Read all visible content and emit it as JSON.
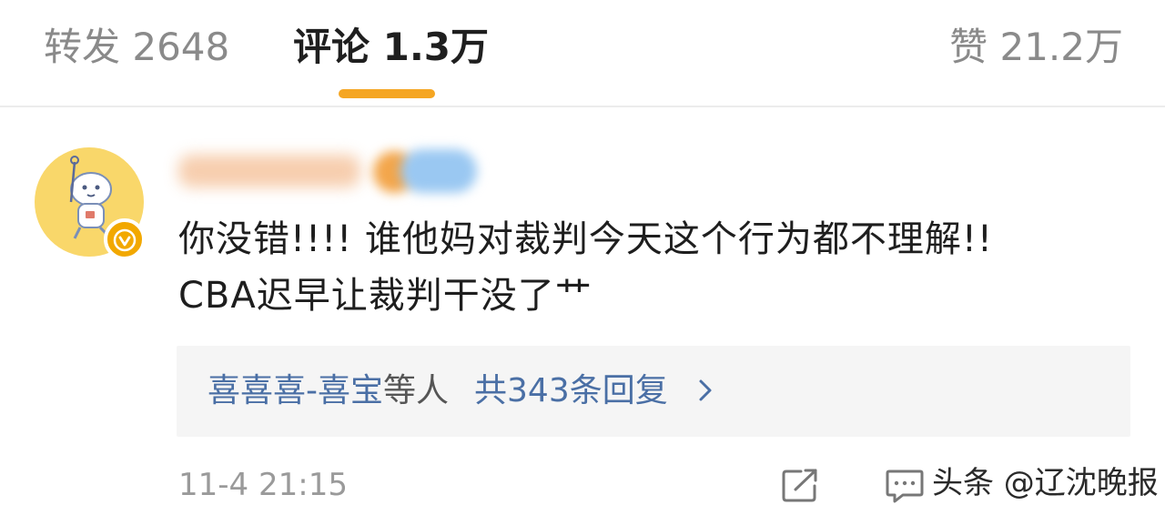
{
  "tabs": {
    "repost_label": "转发 2648",
    "comments_label": "评论 1.3万",
    "likes_label": "赞 21.2万"
  },
  "colors": {
    "accent": "#f5a623",
    "link": "#4a6fa5",
    "avatar_bg": "#f9d76a",
    "verified_badge": "#f2a800"
  },
  "comment": {
    "username": "",
    "text_line1": "你没错!!!! 谁他妈对裁判今天这个行为都不理解!!",
    "text_line2": "CBA迟早让裁判干没了艹",
    "replies": {
      "users": "喜喜喜-喜宝",
      "others": "等人",
      "count_label": "共343条回复"
    },
    "timestamp": "11-4 21:15"
  },
  "icons": {
    "share": "share-icon",
    "comment": "comment-icon",
    "chevron": "chevron-right-icon",
    "verified": "verified-check-icon"
  },
  "watermark": "头条 @辽沈晚报"
}
